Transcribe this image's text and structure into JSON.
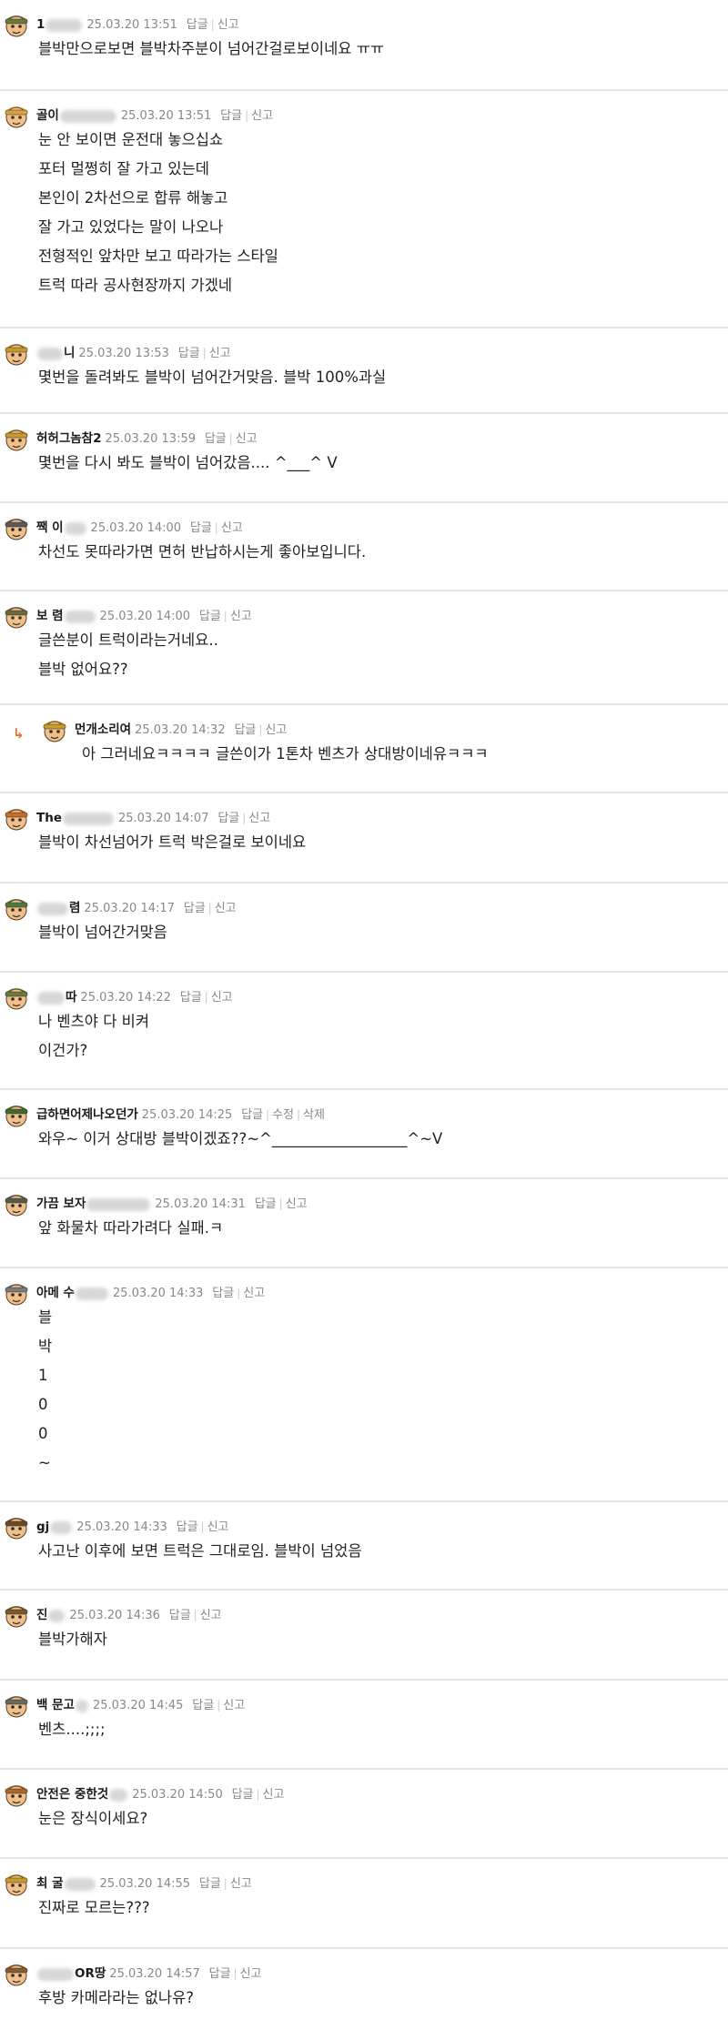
{
  "colors": {
    "separator": "#e4e4e4",
    "meta_text": "#888888",
    "reply_arrow": "#e8702a"
  },
  "actions": {
    "reply": "답글",
    "report": "신고",
    "edit": "수정",
    "delete": "삭제"
  },
  "comments": [
    {
      "nick": "1",
      "date": "25.03.20 13:51",
      "lines": [
        "블박만으로보면 블박차주분이 넘어간걸로보이네요 ㅠㅠ"
      ]
    },
    {
      "nick": "골이",
      "date": "25.03.20 13:51",
      "lines": [
        "눈 안 보이면 운전대 놓으십쇼",
        "포터 멀쩡히 잘 가고 있는데",
        "본인이 2차선으로 합류 해놓고",
        "잘 가고 있었다는 말이 나오나",
        "전형적인 앞차만 보고 따라가는 스타일",
        "트럭 따라 공사현장까지 가겠네"
      ]
    },
    {
      "nick": "니",
      "date": "25.03.20 13:53",
      "lines": [
        "몇번을 돌려봐도 블박이 넘어간거맞음. 블박 100%과실"
      ]
    },
    {
      "nick": "허허그놈참2",
      "date": "25.03.20 13:59",
      "lines": [
        "몇번을 다시 봐도 블박이 넘어갔음.... ^___^ V"
      ]
    },
    {
      "nick": "짹 이",
      "date": "25.03.20 14:00",
      "lines": [
        "차선도 못따라가면 면허 반납하시는게 좋아보입니다."
      ]
    },
    {
      "nick": "보 렴",
      "date": "25.03.20 14:00",
      "lines": [
        "글쓴분이 트럭이라는거네요..",
        "블박 없어요??"
      ]
    },
    {
      "nick": "먼개소리여",
      "date": "25.03.20 14:32",
      "reply": true,
      "lines": [
        "아 그러네요ㅋㅋㅋㅋ 글쓴이가 1톤차 벤츠가 상대방이네유ㅋㅋㅋ"
      ]
    },
    {
      "nick": "The",
      "date": "25.03.20 14:07",
      "lines": [
        "블박이 차선넘어가 트럭 박은걸로 보이네요"
      ]
    },
    {
      "nick": "렴",
      "date": "25.03.20 14:17",
      "lines": [
        "블박이 넘어간거맞음"
      ]
    },
    {
      "nick": "따",
      "date": "25.03.20 14:22",
      "lines": [
        "나 벤츠야 다 비켜",
        "이건가?"
      ]
    },
    {
      "nick": "급하면어제나오던가",
      "date": "25.03.20 14:25",
      "own": true,
      "lines": [
        "와우~ 이거 상대방 블박이겠죠??~^__________________^~V"
      ]
    },
    {
      "nick": "가끔 보자",
      "date": "25.03.20 14:31",
      "lines": [
        "앞 화물차 따라가려다 실패.ㅋ"
      ]
    },
    {
      "nick": "아메 수",
      "date": "25.03.20 14:33",
      "lines": [
        "블",
        "박",
        "1",
        "0",
        "0",
        "~"
      ]
    },
    {
      "nick": "gj",
      "date": "25.03.20 14:33",
      "lines": [
        "사고난 이후에 보면 트럭은 그대로임. 블박이 넘었음"
      ]
    },
    {
      "nick": "진",
      "date": "25.03.20 14:36",
      "lines": [
        "블박가해자"
      ]
    },
    {
      "nick": "백 문고",
      "date": "25.03.20 14:45",
      "lines": [
        "벤츠....;;;;"
      ]
    },
    {
      "nick": "안전은 중한것",
      "date": "25.03.20 14:50",
      "lines": [
        "눈은 장식이세요?"
      ]
    },
    {
      "nick": "최 굴",
      "date": "25.03.20 14:55",
      "lines": [
        "진짜로 모르는???"
      ]
    },
    {
      "nick": "OR땅",
      "date": "25.03.20 14:57",
      "lines": [
        "후방 카메라라는 없나유?"
      ]
    }
  ]
}
